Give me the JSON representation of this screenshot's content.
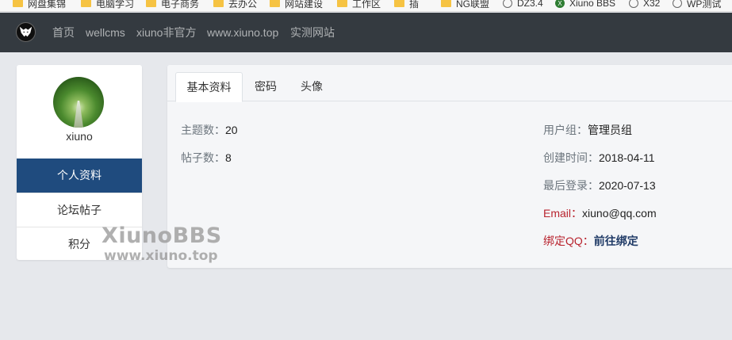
{
  "bookmarks": [
    {
      "label": "网盘集锦",
      "icon": "folder-icon"
    },
    {
      "label": "电脑学习",
      "icon": "folder-icon"
    },
    {
      "label": "电子商务",
      "icon": "folder-icon"
    },
    {
      "label": "去办公",
      "icon": "folder-icon"
    },
    {
      "label": "网站建设",
      "icon": "folder-icon"
    },
    {
      "label": "工作区",
      "icon": "folder-icon"
    },
    {
      "label": "插",
      "icon": "folder-icon"
    },
    {
      "label": "NG联盟",
      "icon": "folder-icon"
    },
    {
      "label": "DZ3.4",
      "icon": "globe-icon"
    },
    {
      "label": "Xiuno BBS",
      "icon": "xiuno-icon"
    },
    {
      "label": "X32",
      "icon": "globe-icon"
    },
    {
      "label": "WP测试",
      "icon": "globe-icon"
    }
  ],
  "nav": {
    "links": [
      "首页",
      "wellcms",
      "xiuno非官方",
      "www.xiuno.top",
      "实测网站"
    ]
  },
  "sidebar": {
    "username": "xiuno",
    "items": [
      "个人资料",
      "论坛帖子",
      "积分"
    ]
  },
  "tabs": [
    "基本资料",
    "密码",
    "头像"
  ],
  "profile": {
    "threads_label": "主题数：",
    "threads_value": "20",
    "posts_label": "帖子数：",
    "posts_value": "8",
    "group_label": "用户组：",
    "group_value": "管理员组",
    "created_label": "创建时间：",
    "created_value": "2018-04-11",
    "lastlogin_label": "最后登录：",
    "lastlogin_value": "2020-07-13",
    "email_label": "Email：",
    "email_value": "xiuno@qq.com",
    "qq_label": "绑定QQ：",
    "qq_value": "前往绑定"
  },
  "watermark": {
    "title": "XiunoBBS",
    "url": "www.xiuno.top"
  },
  "colors": {
    "navbar": "#343a40",
    "sidebar_active": "#1f4b7e",
    "label_red": "#b8232e"
  }
}
